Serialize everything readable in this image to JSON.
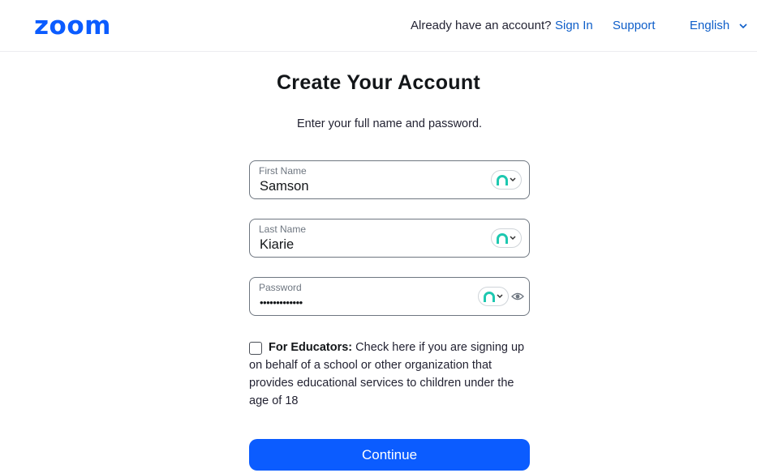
{
  "header": {
    "logo": "zoom",
    "account_prompt": "Already have an account?",
    "sign_in": "Sign In",
    "support": "Support",
    "language": "English"
  },
  "form": {
    "title": "Create Your Account",
    "subtitle": "Enter your full name and password.",
    "first_name": {
      "label": "First Name",
      "value": "Samson"
    },
    "last_name": {
      "label": "Last Name",
      "value": "Kiarie"
    },
    "password": {
      "label": "Password",
      "masked_value": "•••••••••••••"
    },
    "educators": {
      "checked": false,
      "bold_label": "For Educators:",
      "text": " Check here if you are signing up on behalf of a school or other organization that provides educational services to children under the age of 18"
    },
    "continue_label": "Continue"
  },
  "colors": {
    "brand": "#0b5cff",
    "link": "#0e5ec9",
    "password_manager": "#1ec8b0"
  },
  "icons": {
    "password_manager": "password-manager-icon",
    "reveal_password": "eye-icon",
    "language_dropdown": "chevron-down-icon"
  }
}
